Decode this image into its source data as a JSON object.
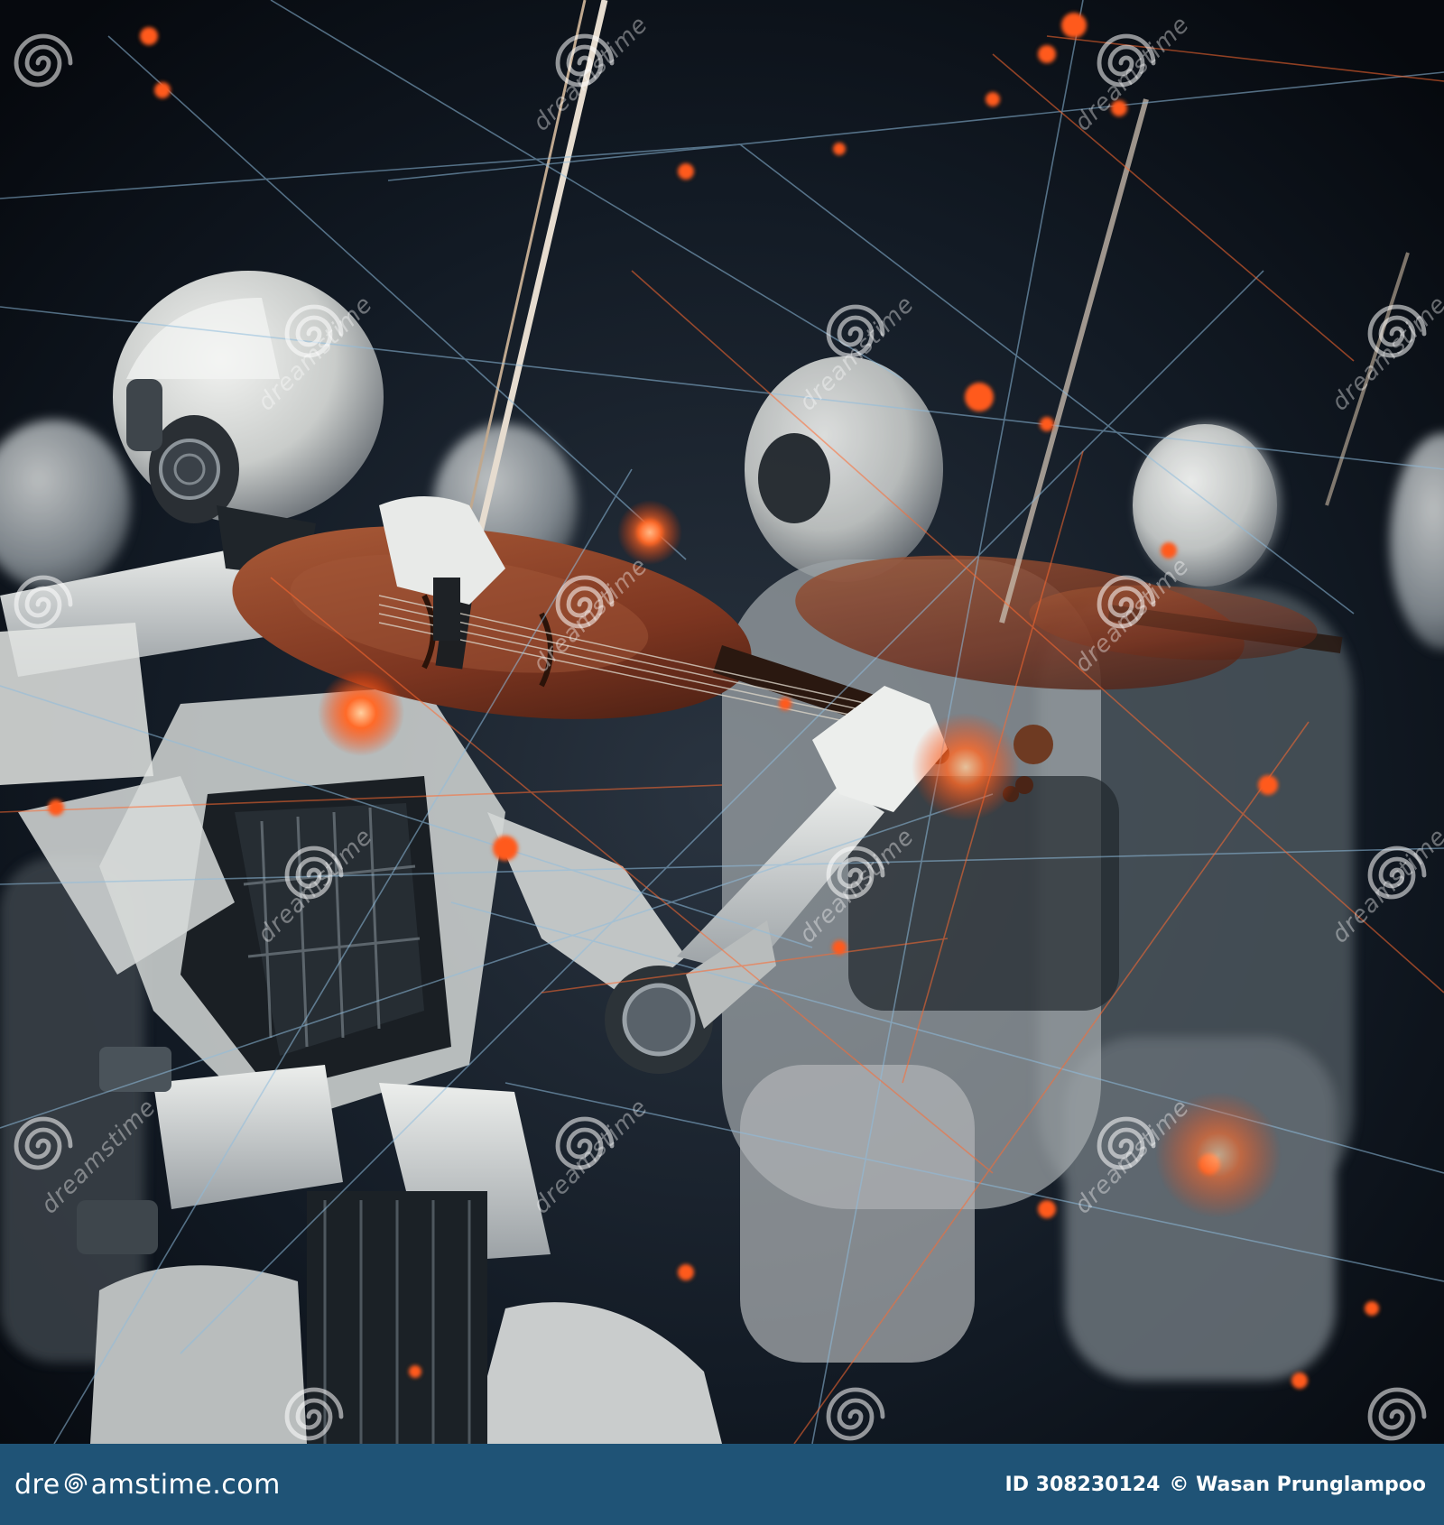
{
  "scene": {
    "subject": "robot violinists orchestra with network lines",
    "colors": {
      "background": "#0a0f16",
      "robot_shell": "#d7d9d6",
      "robot_shadow": "#5b6167",
      "violin": "#8a3f26",
      "spark": "#ff5a1e",
      "network_blue": "#7fb1d6"
    }
  },
  "watermark": {
    "word": "dreamstime",
    "icon": "swirl-icon"
  },
  "footer": {
    "brand_prefix": "dre",
    "brand_suffix": "amstime.com",
    "brand_icon": "swirl-icon",
    "image_id": "ID 308230124",
    "copyright_author": "© Wasan Prunglampoo",
    "background_color": "#1f5376"
  }
}
